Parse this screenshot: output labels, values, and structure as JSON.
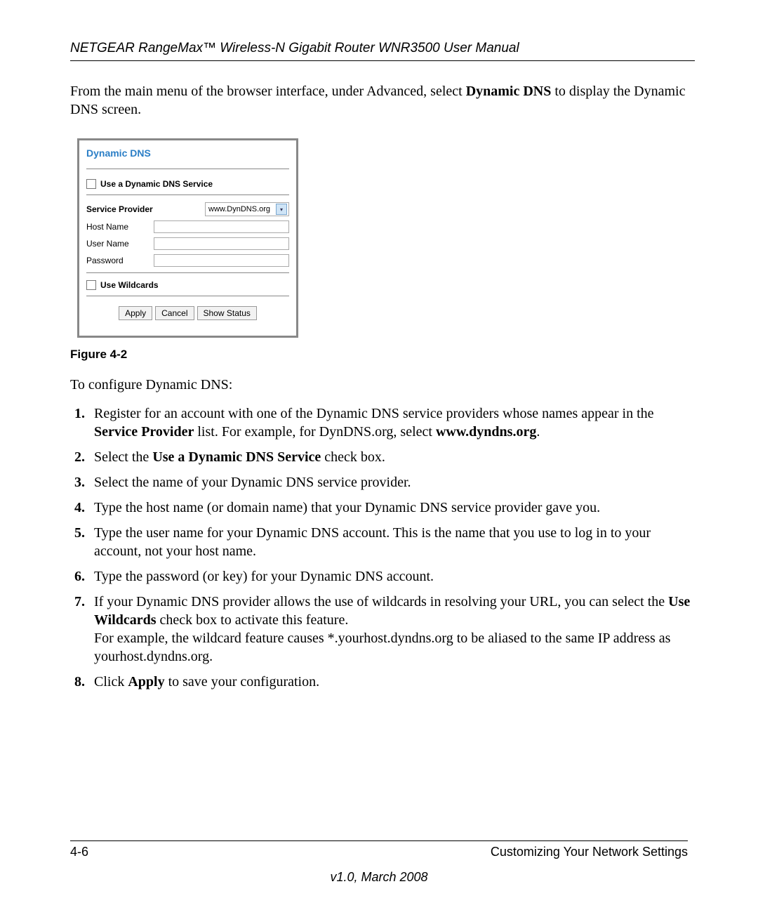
{
  "header": {
    "running_title": "NETGEAR RangeMax™ Wireless-N Gigabit Router WNR3500 User Manual"
  },
  "intro": {
    "pre": "From the main menu of the browser interface, under Advanced, select ",
    "bold": "Dynamic DNS",
    "post": " to display the Dynamic DNS screen."
  },
  "screenshot": {
    "title": "Dynamic DNS",
    "use_dyn_dns_label": "Use a Dynamic DNS Service",
    "service_provider_label": "Service Provider",
    "service_provider_value": "www.DynDNS.org",
    "host_name_label": "Host Name",
    "user_name_label": "User Name",
    "password_label": "Password",
    "use_wildcards_label": "Use Wildcards",
    "buttons": {
      "apply": "Apply",
      "cancel": "Cancel",
      "show_status": "Show Status"
    }
  },
  "figure_caption": "Figure 4-2",
  "config_heading": "To configure Dynamic DNS:",
  "steps": {
    "s1_pre": "Register for an account with one of the Dynamic DNS service providers whose names appear in the ",
    "s1_b1": "Service Provider",
    "s1_mid": " list. For example, for DynDNS.org, select ",
    "s1_b2": "www.dyndns.org",
    "s1_post": ".",
    "s2_pre": "Select the ",
    "s2_b": "Use a Dynamic DNS Service",
    "s2_post": " check box.",
    "s3": "Select the name of your Dynamic DNS service provider.",
    "s4": "Type the host name (or domain name) that your Dynamic DNS service provider gave you.",
    "s5": "Type the user name for your Dynamic DNS account. This is the name that you use to log in to your account, not your host name.",
    "s6": "Type the password (or key) for your Dynamic DNS account.",
    "s7_pre": "If your Dynamic DNS provider allows the use of wildcards in resolving your URL, you can select the ",
    "s7_b": "Use Wildcards",
    "s7_mid": " check box to activate this feature.",
    "s7_post": "For example, the wildcard feature causes *.yourhost.dyndns.org to be aliased to the same IP address as yourhost.dyndns.org.",
    "s8_pre": "Click ",
    "s8_b": "Apply",
    "s8_post": " to save your configuration."
  },
  "footer": {
    "page_num": "4-6",
    "section": "Customizing Your Network Settings",
    "version": "v1.0, March 2008"
  }
}
